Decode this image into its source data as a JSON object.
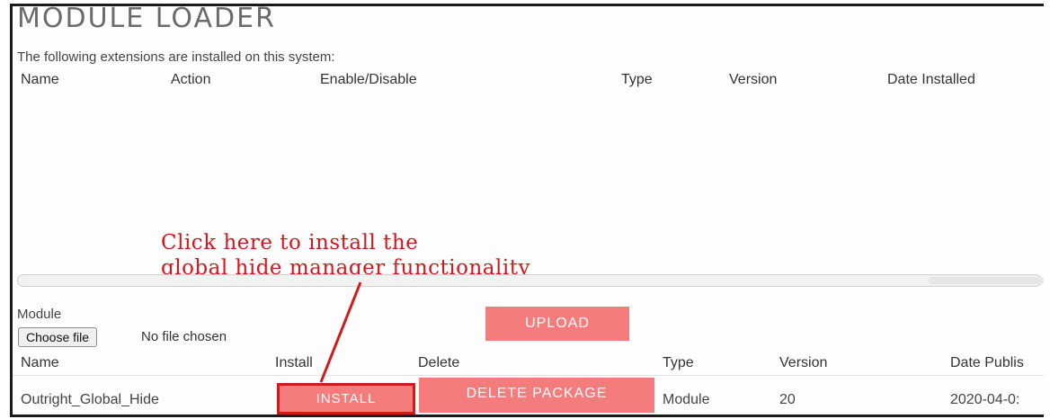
{
  "page": {
    "title": "MODULE LOADER",
    "subtitle": "The following extensions are installed on this system:"
  },
  "installed_table": {
    "headers": [
      "Name",
      "Action",
      "Enable/Disable",
      "Type",
      "Version",
      "Date Installed"
    ],
    "rows": []
  },
  "annotation": {
    "line1": "Click here to install the",
    "line2": "global hide manager functionality",
    "color": "#d2181e"
  },
  "upload": {
    "module_label": "Module",
    "choose_file_label": "Choose file",
    "no_file_text": "No file chosen",
    "upload_button": "UPLOAD"
  },
  "packages_table": {
    "headers": [
      "Name",
      "Install",
      "Delete",
      "Type",
      "Version",
      "Date Publis"
    ],
    "rows": [
      {
        "name": "Outright_Global_Hide",
        "install_label": "INSTALL",
        "delete_label": "DELETE PACKAGE",
        "type": "Module",
        "version": "20",
        "date": "2020-04-0:"
      }
    ]
  },
  "colors": {
    "button_pink": "#f57c7c",
    "highlight_red": "#d11a1a"
  }
}
